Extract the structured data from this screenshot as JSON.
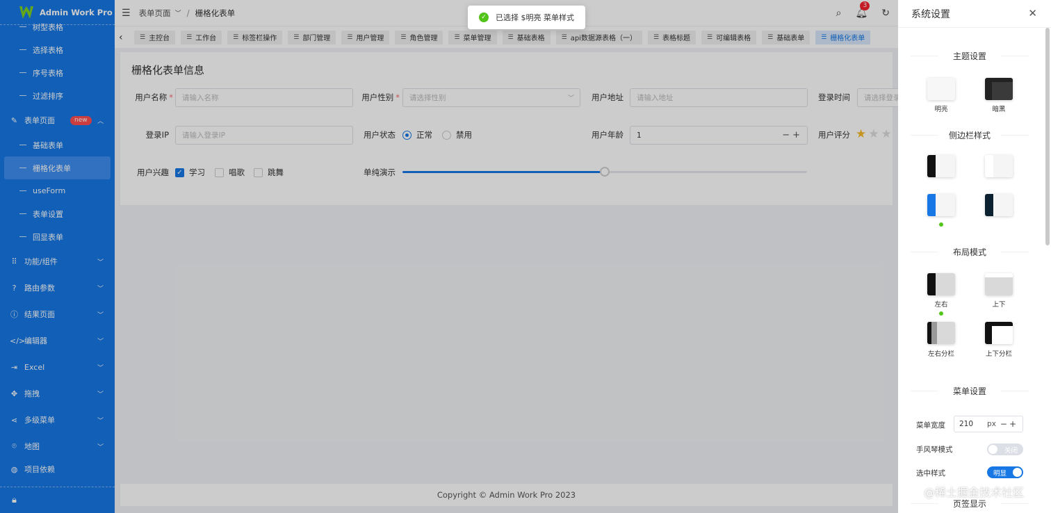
{
  "app": {
    "logo_text": "Admin Work Pro"
  },
  "sidebar": {
    "top_subitems": [
      {
        "label": "树型表格"
      },
      {
        "label": "选择表格"
      },
      {
        "label": "序号表格"
      },
      {
        "label": "过滤排序"
      }
    ],
    "form_group": {
      "label": "表单页面",
      "badge": "new"
    },
    "form_subitems": [
      {
        "label": "基础表单"
      },
      {
        "label": "栅格化表单"
      },
      {
        "label": "useForm"
      },
      {
        "label": "表单设置"
      },
      {
        "label": "回显表单"
      }
    ],
    "groups": [
      {
        "label": "功能/组件",
        "icon": "grid-icon"
      },
      {
        "label": "路由参数",
        "icon": "question-icon"
      },
      {
        "label": "结果页面",
        "icon": "info-icon"
      },
      {
        "label": "编辑器",
        "icon": "code-icon"
      },
      {
        "label": "Excel",
        "icon": "export-icon"
      },
      {
        "label": "拖拽",
        "icon": "move-icon"
      },
      {
        "label": "多级菜单",
        "icon": "share-icon"
      },
      {
        "label": "地图",
        "icon": "location-icon"
      },
      {
        "label": "项目依赖",
        "icon": "globe-icon"
      }
    ]
  },
  "header": {
    "breadcrumb": [
      "表单页面",
      "栅格化表单"
    ],
    "bell_count": "3"
  },
  "tabs": [
    {
      "label": "主控台"
    },
    {
      "label": "工作台"
    },
    {
      "label": "标签栏操作"
    },
    {
      "label": "部门管理"
    },
    {
      "label": "用户管理"
    },
    {
      "label": "角色管理"
    },
    {
      "label": "菜单管理"
    },
    {
      "label": "基础表格"
    },
    {
      "label": "api数据源表格（一）"
    },
    {
      "label": "表格标题"
    },
    {
      "label": "可编辑表格"
    },
    {
      "label": "基础表单"
    },
    {
      "label": "栅格化表单"
    }
  ],
  "form": {
    "title": "栅格化表单信息",
    "username": {
      "label": "用户名称",
      "placeholder": "请输入名称"
    },
    "gender": {
      "label": "用户性别",
      "placeholder": "请选择性别"
    },
    "address": {
      "label": "用户地址",
      "placeholder": "请输入地址"
    },
    "login_time": {
      "label": "登录时间",
      "placeholder": "请选择登录"
    },
    "login_ip": {
      "label": "登录IP",
      "placeholder": "请输入登录IP"
    },
    "status": {
      "label": "用户状态",
      "options": [
        "正常",
        "禁用"
      ],
      "selected": "正常"
    },
    "age": {
      "label": "用户年龄",
      "value": "1"
    },
    "rating": {
      "label": "用户评分",
      "value": 1,
      "visible_stars": 3
    },
    "hobby": {
      "label": "用户兴趣",
      "options": [
        "学习",
        "唱歌",
        "跳舞"
      ],
      "checked": [
        "学习"
      ]
    },
    "slider": {
      "label": "单纯演示",
      "value_fraction": 0.5
    }
  },
  "footer": {
    "text": "Copyright © Admin Work Pro 2023"
  },
  "toast": {
    "text": "已选择 $明亮 菜单样式"
  },
  "drawer": {
    "title": "系统设置",
    "theme": {
      "title": "主题设置",
      "options": [
        "明亮",
        "暗黑"
      ]
    },
    "sidebar_style": {
      "title": "侧边栏样式"
    },
    "layout": {
      "title": "布局模式",
      "options": [
        "左右",
        "上下",
        "左右分栏",
        "上下分栏"
      ]
    },
    "menu": {
      "title": "菜单设置",
      "width_label": "菜单宽度",
      "width_value": "210",
      "width_unit": "px",
      "accordion_label": "手风琴模式",
      "accordion_state": "关闭",
      "selected_style_label": "选中样式",
      "selected_style_state": "明显"
    },
    "tab_display": "页签显示"
  },
  "watermark": "@稀土掘金技术社区",
  "colors": {
    "primary": "#1677e5",
    "success": "#52c41a",
    "danger": "#f5222d"
  }
}
